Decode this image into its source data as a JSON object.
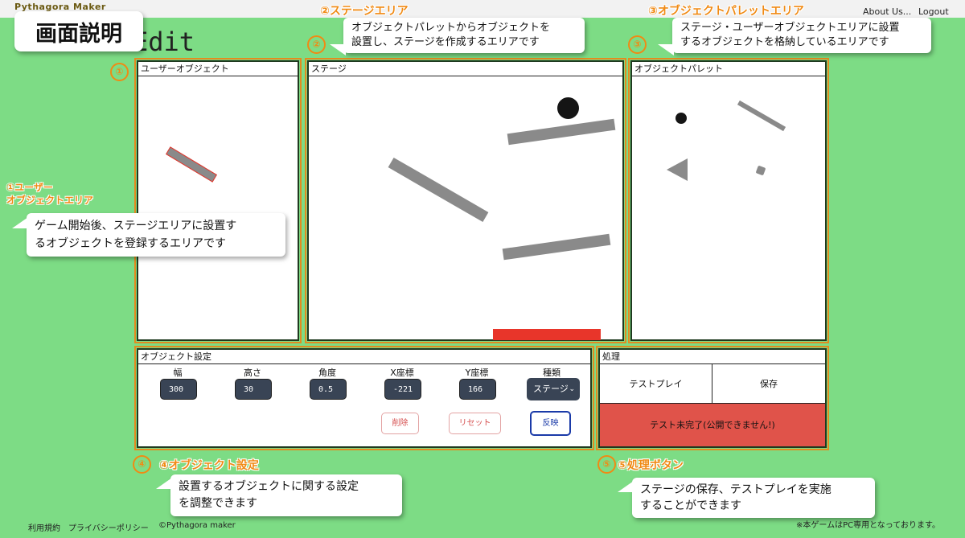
{
  "app": {
    "brand": "Pythagora Maker",
    "title_suffix": "Edit"
  },
  "nav": {
    "about": "About Us...",
    "logout": "Logout"
  },
  "screen_label": "画面説明",
  "panels": {
    "user_objects": "ユーザーオブジェクト",
    "stage": "ステージ",
    "palette": "オブジェクトパレット",
    "settings": "オブジェクト設定",
    "process": "処理"
  },
  "settings": {
    "fields": [
      {
        "label": "幅",
        "value": "300"
      },
      {
        "label": "高さ",
        "value": "30"
      },
      {
        "label": "角度",
        "value": "0.5"
      },
      {
        "label": "X座標",
        "value": "-221"
      },
      {
        "label": "Y座標",
        "value": "166"
      }
    ],
    "type_label": "種類",
    "type_value": "ステージ",
    "delete_label": "削除",
    "reset_label": "リセット",
    "apply_label": "反映"
  },
  "process": {
    "testplay_label": "テストプレイ",
    "save_label": "保存",
    "status_label": "テスト未完了(公開できません!)"
  },
  "annotations": {
    "stage_area": "②ステージエリア",
    "palette_area": "③オブジェクトパレットエリア",
    "user_area_line1": "①ユーザー",
    "user_area_line2": "オブジェクトエリア",
    "settings_area": "④オブジェクト設定",
    "process_area": "⑤処理ボタン",
    "num1": "①",
    "num2": "②",
    "num3": "③",
    "num4": "④",
    "num5": "⑤"
  },
  "callouts": {
    "stage": [
      "オブジェクトパレットからオブジェクトを",
      "設置し、ステージを作成するエリアです"
    ],
    "palette": [
      "ステージ・ユーザーオブジェクトエリアに設置",
      "するオブジェクトを格納しているエリアです"
    ],
    "user": [
      "ゲーム開始後、ステージエリアに設置す",
      "るオブジェクトを登録するエリアです"
    ],
    "settings": [
      "設置するオブジェクトに関する設定",
      "を調整できます"
    ],
    "process": [
      "ステージの保存、テストプレイを実施",
      "することができます"
    ]
  },
  "footer": {
    "terms": "利用規約",
    "privacy": "プライバシーポリシー",
    "copyright": "©Pythagora maker",
    "notice": "※本ゲームはPC専用となっております。"
  },
  "colors": {
    "background": "#7ddc85",
    "highlight": "#f08a14",
    "status_bg": "#e0534a",
    "goal": "#e8352a"
  }
}
